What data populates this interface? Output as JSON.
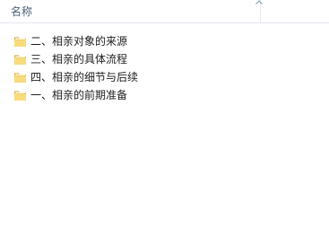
{
  "header": {
    "name_column_label": "名称",
    "sort_icon": "sort-ascending-icon"
  },
  "files": [
    {
      "name": "二、相亲对象的来源",
      "icon": "folder-icon"
    },
    {
      "name": "三、相亲的具体流程",
      "icon": "folder-icon"
    },
    {
      "name": "四、相亲的细节与后续",
      "icon": "folder-icon"
    },
    {
      "name": "一、相亲的前期准备",
      "icon": "folder-icon"
    }
  ],
  "colors": {
    "header_text": "#4c607a",
    "folder_light": "#f7dc7e",
    "folder_dark": "#d9a53a",
    "sort_arrow": "#7e9bbd"
  }
}
